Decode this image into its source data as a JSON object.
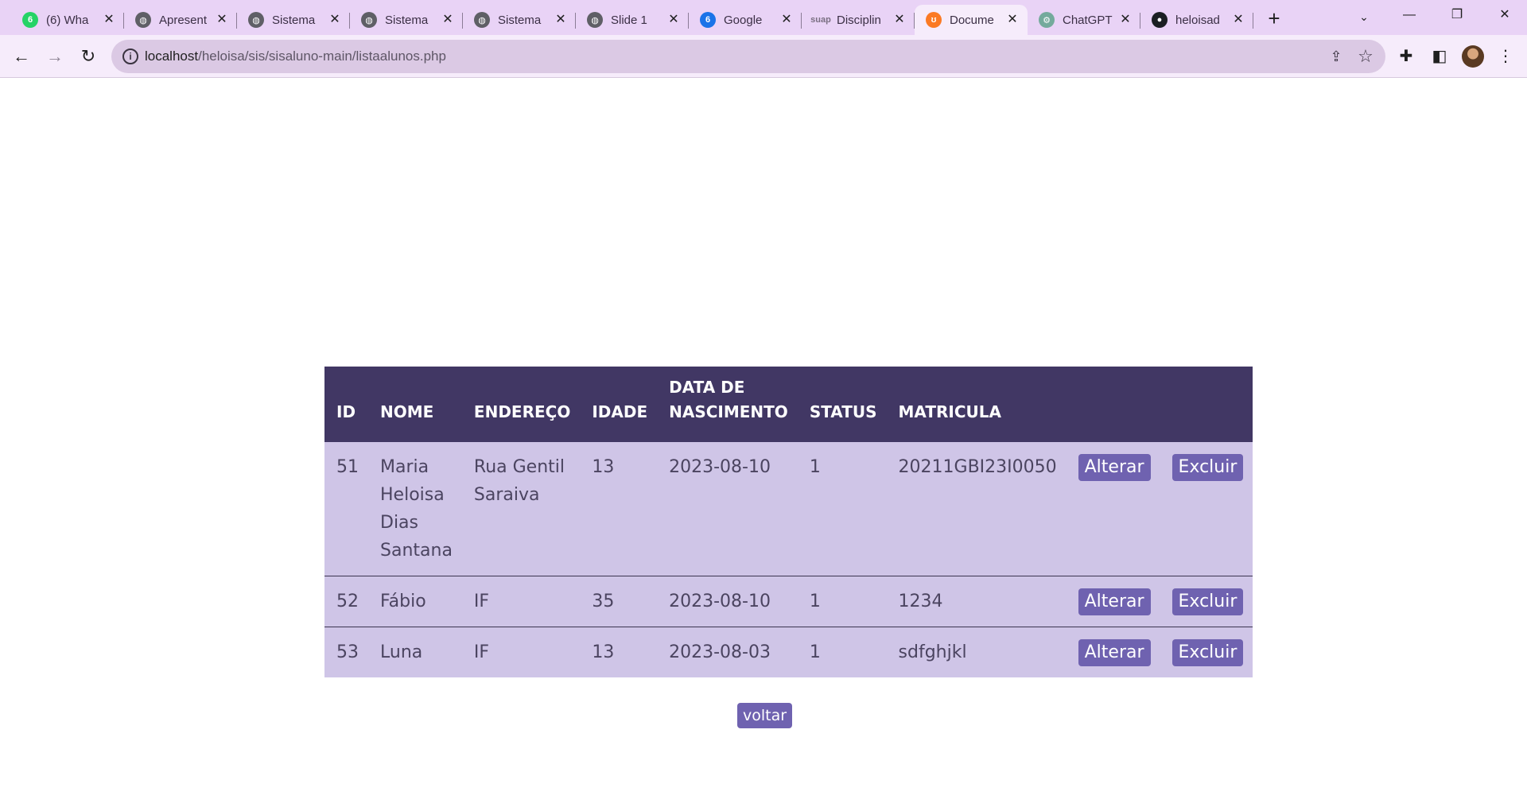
{
  "browser": {
    "tabs": [
      {
        "title": "(6) Wha",
        "favicon": "whatsapp-icon",
        "favicon_text": "6"
      },
      {
        "title": "Apresent",
        "favicon": "globe-icon",
        "favicon_text": "◍"
      },
      {
        "title": "Sistema",
        "favicon": "globe-icon",
        "favicon_text": "◍"
      },
      {
        "title": "Sistema",
        "favicon": "globe-icon",
        "favicon_text": "◍"
      },
      {
        "title": "Sistema",
        "favicon": "globe-icon",
        "favicon_text": "◍"
      },
      {
        "title": "Slide 1",
        "favicon": "globe-icon",
        "favicon_text": "◍"
      },
      {
        "title": "Google",
        "favicon": "google-docs-icon",
        "favicon_text": "6"
      },
      {
        "title": "Disciplin",
        "favicon": "suap-icon",
        "favicon_text": "suap"
      },
      {
        "title": "Docume",
        "favicon": "xampp-icon",
        "favicon_text": "ʊ",
        "active": true
      },
      {
        "title": "ChatGPT",
        "favicon": "chatgpt-icon",
        "favicon_text": "⚙"
      },
      {
        "title": "heloisad",
        "favicon": "github-icon",
        "favicon_text": "●"
      }
    ],
    "url_host": "localhost",
    "url_path": "/heloisa/sis/sisaluno-main/listaalunos.php"
  },
  "table": {
    "headers": {
      "id": "ID",
      "nome": "NOME",
      "endereco": "ENDEREÇO",
      "idade": "IDADE",
      "data_line1": "DATA DE",
      "data_line2": "NASCIMENTO",
      "status": "STATUS",
      "matricula": "MATRICULA"
    },
    "rows": [
      {
        "id": "51",
        "nome": "Maria Heloisa Dias Santana",
        "endereco": "Rua Gentil Saraiva",
        "idade": "13",
        "data": "2023-08-10",
        "status": "1",
        "matricula": "20211GBI23I0050",
        "alterar": "Alterar",
        "excluir": "Excluir"
      },
      {
        "id": "52",
        "nome": "Fábio",
        "endereco": "IF",
        "idade": "35",
        "data": "2023-08-10",
        "status": "1",
        "matricula": "1234",
        "alterar": "Alterar",
        "excluir": "Excluir"
      },
      {
        "id": "53",
        "nome": "Luna",
        "endereco": "IF",
        "idade": "13",
        "data": "2023-08-03",
        "status": "1",
        "matricula": "sdfghjkl",
        "alterar": "Alterar",
        "excluir": "Excluir"
      }
    ]
  },
  "voltar_label": "voltar",
  "colors": {
    "tabstrip": "#e9d3f6",
    "header_bg": "#413764",
    "row_bg": "#cfc5e7",
    "button_bg": "#6f62b0"
  }
}
